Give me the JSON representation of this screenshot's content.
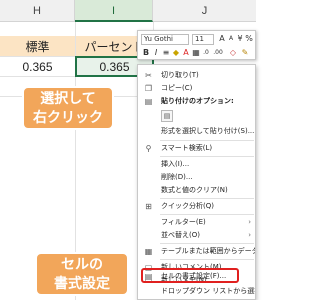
{
  "sheet": {
    "columns": [
      "H",
      "I",
      "J"
    ],
    "header_row": [
      "標準",
      "パーセント"
    ],
    "value_row": [
      "0.365",
      "0.365"
    ]
  },
  "callouts": {
    "right_click": [
      "選択して",
      "右クリック"
    ],
    "format_cells": [
      "セルの",
      "書式設定"
    ]
  },
  "mini_toolbar": {
    "font_name": "Yu Gothi",
    "font_size": "11",
    "icons": [
      "font-grow-icon",
      "font-shrink-icon",
      "currency-icon",
      "percent-icon",
      "comma-icon",
      "format-painter-icon",
      "bold-icon",
      "italic-icon",
      "align-icon",
      "fill-color-icon",
      "font-color-icon",
      "borders-icon",
      "decrease-decimal-icon",
      "increase-decimal-icon",
      "eraser-icon"
    ]
  },
  "context_menu": {
    "items": [
      {
        "label": "切り取り(T)",
        "icon": "scissors-icon"
      },
      {
        "label": "コピー(C)",
        "icon": "copy-icon"
      },
      {
        "label": "貼り付けのオプション:",
        "icon": "paste-icon",
        "bold": true
      },
      {
        "label": "形式を選択して貼り付け(S)...",
        "icon": ""
      },
      {
        "label": "スマート検索(L)",
        "icon": "search-icon"
      },
      {
        "label": "挿入(I)...",
        "icon": ""
      },
      {
        "label": "削除(D)...",
        "icon": ""
      },
      {
        "label": "数式と値のクリア(N)",
        "icon": ""
      },
      {
        "label": "クイック分析(Q)",
        "icon": "quick-analysis-icon"
      },
      {
        "label": "フィルター(E)",
        "icon": "",
        "submenu": true
      },
      {
        "label": "並べ替え(O)",
        "icon": "",
        "submenu": true
      },
      {
        "label": "テーブルまたは範囲からデータを取得(G)...",
        "icon": "table-icon"
      },
      {
        "label": "新しいコメント(M)",
        "icon": "comment-icon"
      },
      {
        "label": "新しいメモ(N)",
        "icon": "note-icon"
      },
      {
        "label": "セルの書式設定(F)...",
        "icon": "format-cells-icon",
        "highlighted": true
      },
      {
        "label": "ドロップダウン リストから選択(K)...",
        "icon": ""
      }
    ]
  },
  "colors": {
    "callout": "#f2a65a",
    "highlight": "#e0201f",
    "selection": "#217346",
    "header_fill": "#fce4c4"
  }
}
